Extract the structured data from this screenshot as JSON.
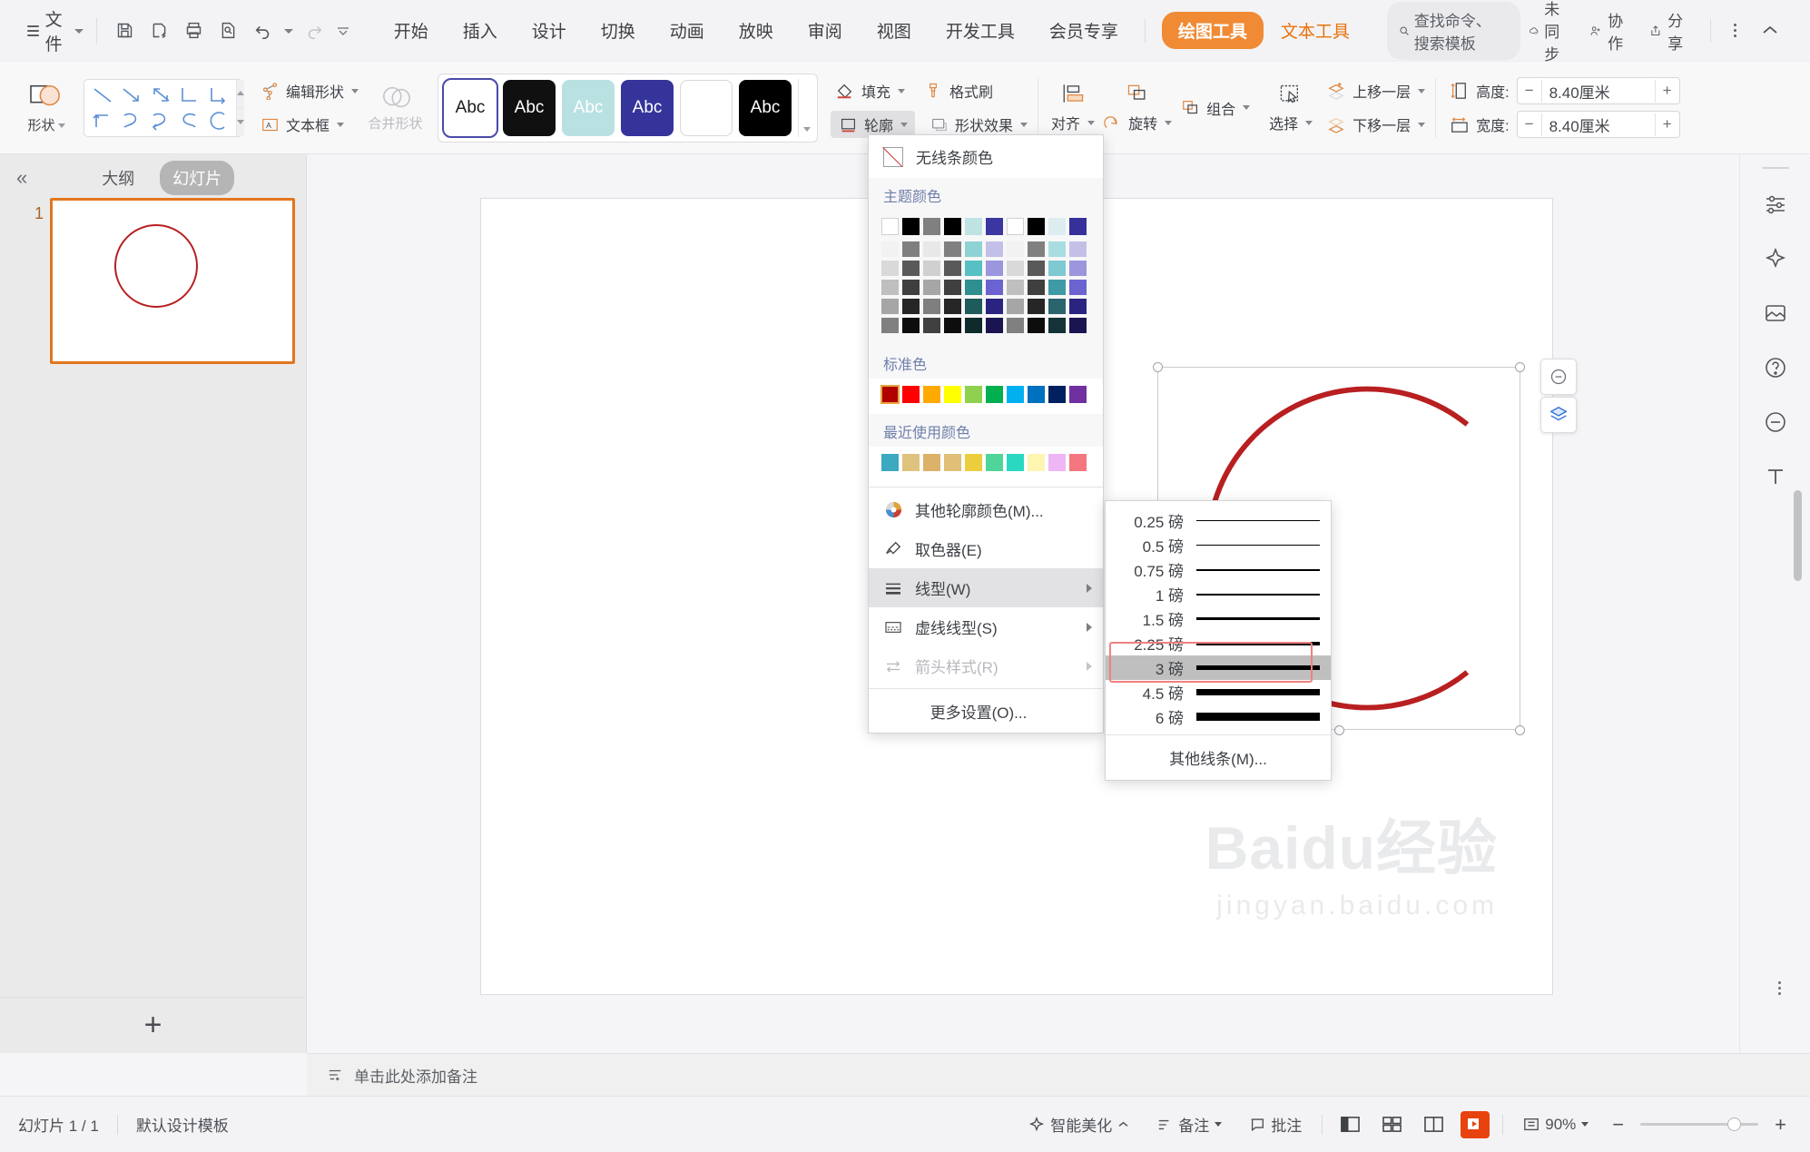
{
  "titlebar": {
    "file_menu": "文件",
    "quick_access": [
      "save-icon",
      "save-as-icon",
      "print-icon",
      "print-preview-icon",
      "undo-icon",
      "redo-icon",
      "customize-qat-icon"
    ],
    "tabs": [
      {
        "label": "开始",
        "style": "normal"
      },
      {
        "label": "插入",
        "style": "normal"
      },
      {
        "label": "设计",
        "style": "normal"
      },
      {
        "label": "切换",
        "style": "normal"
      },
      {
        "label": "动画",
        "style": "normal"
      },
      {
        "label": "放映",
        "style": "normal"
      },
      {
        "label": "审阅",
        "style": "normal"
      },
      {
        "label": "视图",
        "style": "normal"
      },
      {
        "label": "开发工具",
        "style": "normal"
      },
      {
        "label": "会员专享",
        "style": "normal"
      },
      {
        "label": "绘图工具",
        "style": "pill"
      },
      {
        "label": "文本工具",
        "style": "orange"
      }
    ],
    "search_placeholder": "查找命令、搜索模板",
    "right_items": [
      {
        "label": "未同步",
        "icon": "cloud-sync-icon"
      },
      {
        "label": "协作",
        "icon": "collaborate-icon"
      },
      {
        "label": "分享",
        "icon": "share-icon"
      }
    ],
    "more_icon": "more-vertical-icon",
    "collapse_icon": "chevron-up-icon",
    "accent_color": "#f08a34"
  },
  "ribbon": {
    "shape_button": "形状",
    "edit_shape": "编辑形状",
    "text_box": "文本框",
    "merge_shapes": "合并形状",
    "style_swatches": [
      {
        "label": "Abc",
        "bg": "#ffffff",
        "fg": "#1b1b1b",
        "selected": true
      },
      {
        "label": "Abc",
        "bg": "#101010",
        "fg": "#ffffff",
        "selected": false
      },
      {
        "label": "Abc",
        "bg": "#b9e1e2",
        "fg": "#ffffff",
        "selected": false
      },
      {
        "label": "Abc",
        "bg": "#35349a",
        "fg": "#ffffff",
        "selected": false
      },
      {
        "label": "",
        "bg": "#ffffff",
        "fg": "#ffffff",
        "selected": false
      },
      {
        "label": "Abc",
        "bg": "#000000",
        "fg": "#ffffff",
        "selected": false
      }
    ],
    "fill": "填充",
    "outline": "轮廓",
    "format_painter": "格式刷",
    "shape_effects": "形状效果",
    "align": "对齐",
    "rotate": "旋转",
    "group": "组合",
    "select": "选择",
    "bring_forward": "上移一层",
    "send_backward": "下移一层",
    "height_label": "高度:",
    "height_value": "8.40厘米",
    "width_label": "宽度:",
    "width_value": "8.40厘米"
  },
  "left_panel": {
    "collapse": "«",
    "tab_outline": "大纲",
    "tab_slides": "幻灯片",
    "slide_number": "1",
    "add_slide_icon": "plus-icon"
  },
  "canvas": {
    "shape_color": "#b81f20",
    "watermark_line1": "Baidu经验",
    "watermark_line2": "jingyan.baidu.com"
  },
  "outline_menu": {
    "no_line": "无线条颜色",
    "theme_colors_label": "主题颜色",
    "theme_rows": [
      [
        "#ffffff",
        "#000000",
        "#808080",
        "#000000",
        "#bfe3e3",
        "#3c37a0",
        "#ffffff",
        "#000000",
        "#dcecef",
        "#36309b"
      ],
      [
        "#f2f2f2",
        "#7f7f7f",
        "#e8e8e8",
        "#808080",
        "#8ed3d4",
        "#c3c0e8",
        "#f2f2f2",
        "#808080",
        "#a9dde2",
        "#c3c0e8"
      ],
      [
        "#d9d9d9",
        "#595959",
        "#d0d0d0",
        "#595959",
        "#56c0c2",
        "#9b96dd",
        "#d9d9d9",
        "#595959",
        "#7fc9d2",
        "#9b96dd"
      ],
      [
        "#bfbfbf",
        "#3f3f3f",
        "#a6a6a6",
        "#3f3f3f",
        "#2f8e90",
        "#6a63d0",
        "#bfbfbf",
        "#3f3f3f",
        "#3f9aa6",
        "#6a63d0"
      ],
      [
        "#a6a6a6",
        "#262626",
        "#7f7f7f",
        "#262626",
        "#1d5b5c",
        "#2a2480",
        "#a6a6a6",
        "#262626",
        "#2a646d",
        "#2a2480"
      ],
      [
        "#808080",
        "#0d0d0d",
        "#404040",
        "#0d0d0d",
        "#0d2b2b",
        "#1a1550",
        "#808080",
        "#0d0d0d",
        "#143238",
        "#1a1550"
      ]
    ],
    "standard_colors_label": "标准色",
    "standard_colors": [
      "#b00000",
      "#ff0000",
      "#ffaa00",
      "#ffff00",
      "#8fd14f",
      "#00b050",
      "#00b0f0",
      "#0070c0",
      "#002060",
      "#7030a0"
    ],
    "standard_selected_index": 0,
    "recent_colors_label": "最近使用颜色",
    "recent_colors": [
      "#3ba9bf",
      "#dfc27d",
      "#dcb169",
      "#e0c077",
      "#eccd3e",
      "#4fd49a",
      "#2ad8c2",
      "#fdf5b0",
      "#eeb6f5",
      "#f4767f"
    ],
    "items": [
      {
        "label": "其他轮廓颜色(M)...",
        "icon": "color-wheel-icon",
        "arrow": false,
        "state": "normal"
      },
      {
        "label": "取色器(E)",
        "icon": "eyedropper-icon",
        "arrow": false,
        "state": "normal"
      },
      {
        "label": "线型(W)",
        "icon": "line-weight-icon",
        "arrow": true,
        "state": "highlighted"
      },
      {
        "label": "虚线线型(S)",
        "icon": "dashed-line-icon",
        "arrow": true,
        "state": "normal"
      },
      {
        "label": "箭头样式(R)",
        "icon": "arrow-style-icon",
        "arrow": true,
        "state": "disabled"
      }
    ],
    "more_settings": "更多设置(O)..."
  },
  "line_weight_submenu": {
    "options": [
      {
        "label": "0.25 磅",
        "thickness": 1,
        "selected": false
      },
      {
        "label": "0.5 磅",
        "thickness": 1,
        "selected": false
      },
      {
        "label": "0.75 磅",
        "thickness": 2,
        "selected": false
      },
      {
        "label": "1 磅",
        "thickness": 2,
        "selected": false
      },
      {
        "label": "1.5 磅",
        "thickness": 3,
        "selected": false
      },
      {
        "label": "2.25 磅",
        "thickness": 4,
        "selected": false
      },
      {
        "label": "3 磅",
        "thickness": 5,
        "selected": true
      },
      {
        "label": "4.5 磅",
        "thickness": 7,
        "selected": false
      },
      {
        "label": "6 磅",
        "thickness": 9,
        "selected": false
      }
    ],
    "more_lines": "其他线条(M)..."
  },
  "notes": {
    "placeholder": "单击此处添加备注",
    "icon": "notes-icon"
  },
  "statusbar": {
    "slide_counter": "幻灯片 1 / 1",
    "template": "默认设计模板",
    "beautify": "智能美化",
    "notes_btn": "备注",
    "comment_btn": "批注",
    "zoom_level": "90%",
    "view_buttons": [
      "normal-view-icon",
      "slide-sorter-icon",
      "reading-view-icon",
      "play-slideshow-icon"
    ]
  }
}
